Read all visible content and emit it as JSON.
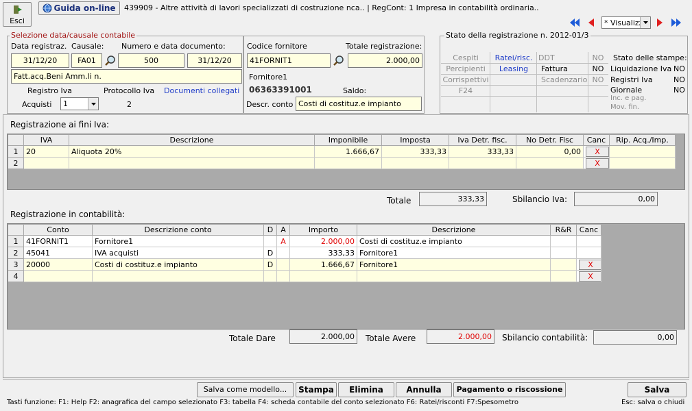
{
  "toolbar": {
    "exit_label": "Esci",
    "help_label": "Guida on-line",
    "info_text": "439909 - Altre attività di lavori specializzati di costruzione nca.. | RegCont: 1 Impresa  in contabilità ordinaria..",
    "view_select": "* Visualizz"
  },
  "selezione": {
    "title": "Selezione data/causale contabile",
    "data_label": "Data registraz.",
    "causale_label": "Causale:",
    "numero_label": "Numero e data documento:",
    "data_value": "31/12/20",
    "causale_value": "FA01",
    "numero_value": "500",
    "data_doc_value": "31/12/20",
    "descr_causale": "Fatt.acq.Beni Amm.li n.",
    "registro_label": "Registro Iva",
    "protocollo_label": "Protocollo Iva",
    "documenti_link": "Documenti collegati",
    "registro_name": "Acquisti",
    "registro_value": "1",
    "protocollo_value": "2"
  },
  "fornitore": {
    "codice_label": "Codice fornitore",
    "totale_label": "Totale registrazione:",
    "codice_value": "41FORNIT1",
    "totale_value": "2.000,00",
    "nome": "Fornitore1",
    "piva": "06363391001",
    "saldo_label": "Saldo:",
    "descr_conto_label": "Descr. conto",
    "descr_conto_value": "Costi di costituz.e impianto"
  },
  "stato": {
    "title": "Stato della registrazione n. 2012-01/3",
    "col1": [
      "Cespiti",
      "Percipienti",
      "Corrispettivi",
      "F24"
    ],
    "col2": [
      "Ratei/risc.",
      "Leasing"
    ],
    "col3": [
      "DDT",
      "Fattura",
      "Scadenzario"
    ],
    "col3_values": [
      "NO",
      "NO",
      "NO"
    ],
    "stampe_title": "Stato delle stampe:",
    "stampe": [
      {
        "label": "Liquidazione Iva",
        "value": "NO"
      },
      {
        "label": "Registri Iva",
        "value": "NO"
      },
      {
        "label": "Giornale",
        "value": "NO"
      }
    ],
    "stampe_grey": [
      "Inc. e pag.",
      "Mov. fin."
    ]
  },
  "iva": {
    "title": "Registrazione ai fini Iva:",
    "headers": [
      "IVA",
      "Descrizione",
      "Imponibile",
      "Imposta",
      "Iva Detr. fisc.",
      "No Detr. Fisc",
      "Canc",
      "Rip. Acq./Imp."
    ],
    "rows": [
      {
        "n": "1",
        "iva": "20",
        "descr": "Aliquota 20%",
        "imponibile": "1.666,67",
        "imposta": "333,33",
        "detr": "333,33",
        "nodetr": "0,00",
        "canc": "X",
        "rip": ""
      },
      {
        "n": "2",
        "iva": "",
        "descr": "",
        "imponibile": "",
        "imposta": "",
        "detr": "",
        "nodetr": "",
        "canc": "X",
        "rip": ""
      }
    ],
    "totale_label": "Totale",
    "totale_value": "333,33",
    "sbilancio_label": "Sbilancio Iva:",
    "sbilancio_value": "0,00"
  },
  "contabilita": {
    "title": "Registrazione in contabilità:",
    "headers": [
      "Conto",
      "Descrizione conto",
      "D",
      "A",
      "Importo",
      "Descrizione",
      "R&R",
      "Canc"
    ],
    "rows": [
      {
        "n": "1",
        "conto": "41FORNIT1",
        "descr_conto": "Fornitore1",
        "d": "",
        "a": "A",
        "importo": "2.000,00",
        "descr": "Costi di costituz.e impianto",
        "rr": "",
        "canc": ""
      },
      {
        "n": "2",
        "conto": "45041",
        "descr_conto": "IVA acquisti",
        "d": "D",
        "a": "",
        "importo": "333,33",
        "descr": "Fornitore1",
        "rr": "",
        "canc": ""
      },
      {
        "n": "3",
        "conto": "20000",
        "descr_conto": "Costi di costituz.e impianto",
        "d": "D",
        "a": "",
        "importo": "1.666,67",
        "descr": "Fornitore1",
        "rr": "",
        "canc": "X"
      },
      {
        "n": "4",
        "conto": "",
        "descr_conto": "",
        "d": "",
        "a": "",
        "importo": "",
        "descr": "",
        "rr": "",
        "canc": "X"
      }
    ],
    "totale_dare_label": "Totale Dare",
    "totale_dare_value": "2.000,00",
    "totale_avere_label": "Totale Avere",
    "totale_avere_value": "2.000,00",
    "sbilancio_label": "Sbilancio contabilità:",
    "sbilancio_value": "0,00"
  },
  "bottom": {
    "salva_modello": "Salva come modello...",
    "stampa": "Stampa",
    "elimina": "Elimina",
    "annulla": "Annulla",
    "pagamento": "Pagamento o riscossione",
    "salva": "Salva",
    "shortcuts": "Tasti funzione:  F1: Help  F2: anagrafica del campo selezionato   F3: tabella   F4: scheda contabile del conto selezionato   F6: Ratei/risconti     F7:Spesometro",
    "esc_hint": "Esc: salva o chiudi"
  },
  "colors": {
    "field_bg": "#ffffe1",
    "grid_bg": "#aaaaaa",
    "link_blue": "#1f3cc8",
    "alert_red": "#e00000"
  }
}
